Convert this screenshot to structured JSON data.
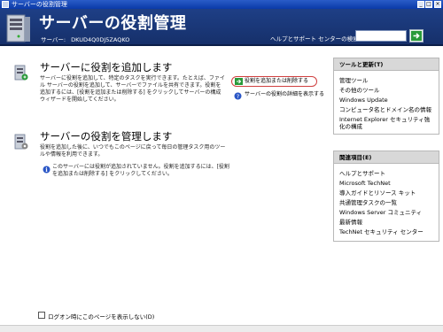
{
  "window": {
    "title": "サーバーの役割管理"
  },
  "banner": {
    "title": "サーバーの役割管理",
    "server_label": "サーバー:",
    "server_name": "DKUD4Q0DJ5ZAQKO",
    "search_label": "ヘルプとサポート センターの検索(S)"
  },
  "add_role": {
    "title": "サーバーに役割を追加します",
    "description": "サーバーに役割を追加して、特定のタスクを実行できます。たとえば、ファイル サーバーの役割を追加して、サーバーでファイルを共有できます。役割を追加するには、[役割を追加または削除する] をクリックしてサーバーの構成ウィザードを開始してください。",
    "action_link": "役割を追加または削除する",
    "help_link": "サーバーの役割の詳細を表示する"
  },
  "manage_role": {
    "title": "サーバーの役割を管理します",
    "description": "役割を追加した後に、いつでもこのページに戻って毎日の管理タスク用のツールや情報を利用できます。",
    "info": "このサーバーには役割が追加されていません。役割を追加するには、[役割を追加または削除する] をクリックしてください。"
  },
  "footer": {
    "checkbox_label": "ログオン時にこのページを表示しない(D)"
  },
  "tools_panel": {
    "title": "ツールと更新(T)",
    "items": [
      "管理ツール",
      "その他のツール",
      "Windows Update",
      "コンピュータ名とドメイン名の情報",
      "Internet Explorer セキュリティ強化の構成"
    ]
  },
  "related_panel": {
    "title": "関連項目(E)",
    "items": [
      "ヘルプとサポート",
      "Microsoft TechNet",
      "導入ガイドとリソース キット",
      "共通管理タスクの一覧",
      "Windows Server コミュニティ",
      "最新情報",
      "TechNet セキュリティ センター"
    ]
  },
  "colors": {
    "banner": "#1e3f86",
    "titlebar": "#0a3aa8",
    "panel_header": "#d8d8d8",
    "action_arrow": "#2a9a3a"
  }
}
